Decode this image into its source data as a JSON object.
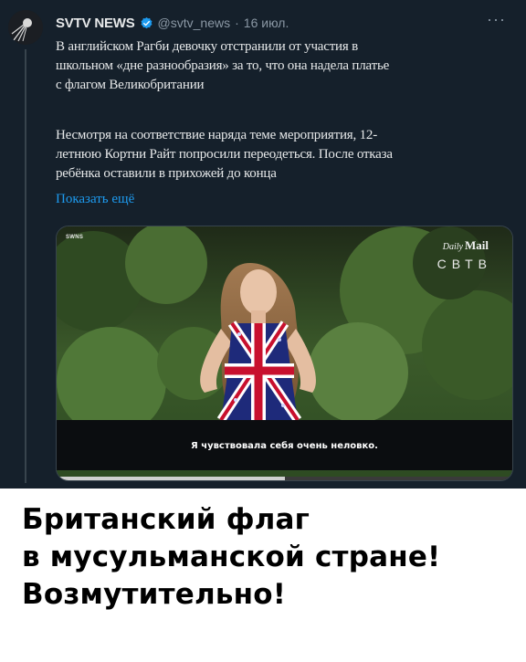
{
  "tweet": {
    "author_name": "SVTV NEWS",
    "handle": "@svtv_news",
    "separator": "·",
    "date": "16 июл.",
    "more_icon_label": "···",
    "verified_icon": "verified-badge-icon",
    "paragraph1_lines": [
      "В английском Рагби девочку отстранили от участия в",
      "школьном «дне разнообразия» за то, что она надела платье",
      "с флагом Великобритании"
    ],
    "paragraph2_lines": [
      "Несмотря на соответствие наряда теме мероприятия, 12-",
      "летнюю Кортни Райт попросили переодеться. После отказа",
      "ребёнка оставили в прихожей до конца"
    ],
    "show_more": "Показать ещё"
  },
  "media": {
    "agency_watermark": "SWNS",
    "logo_daily": "Daily",
    "logo_mail": "Mail",
    "channel_logo": "СВТВ",
    "subtitle": "Я чувствовала себя очень неловко.",
    "progress_fraction": 0.5
  },
  "caption": {
    "lines": [
      "Британский флаг",
      "в мусульманской стране!",
      "Возмутительно!"
    ]
  },
  "colors": {
    "tweet_background": "#15202b",
    "text": "#e7e9ea",
    "secondary_text": "#8b98a5",
    "link": "#1d9bf0",
    "verified": "#1d9bf0",
    "caption_text": "#000000"
  }
}
